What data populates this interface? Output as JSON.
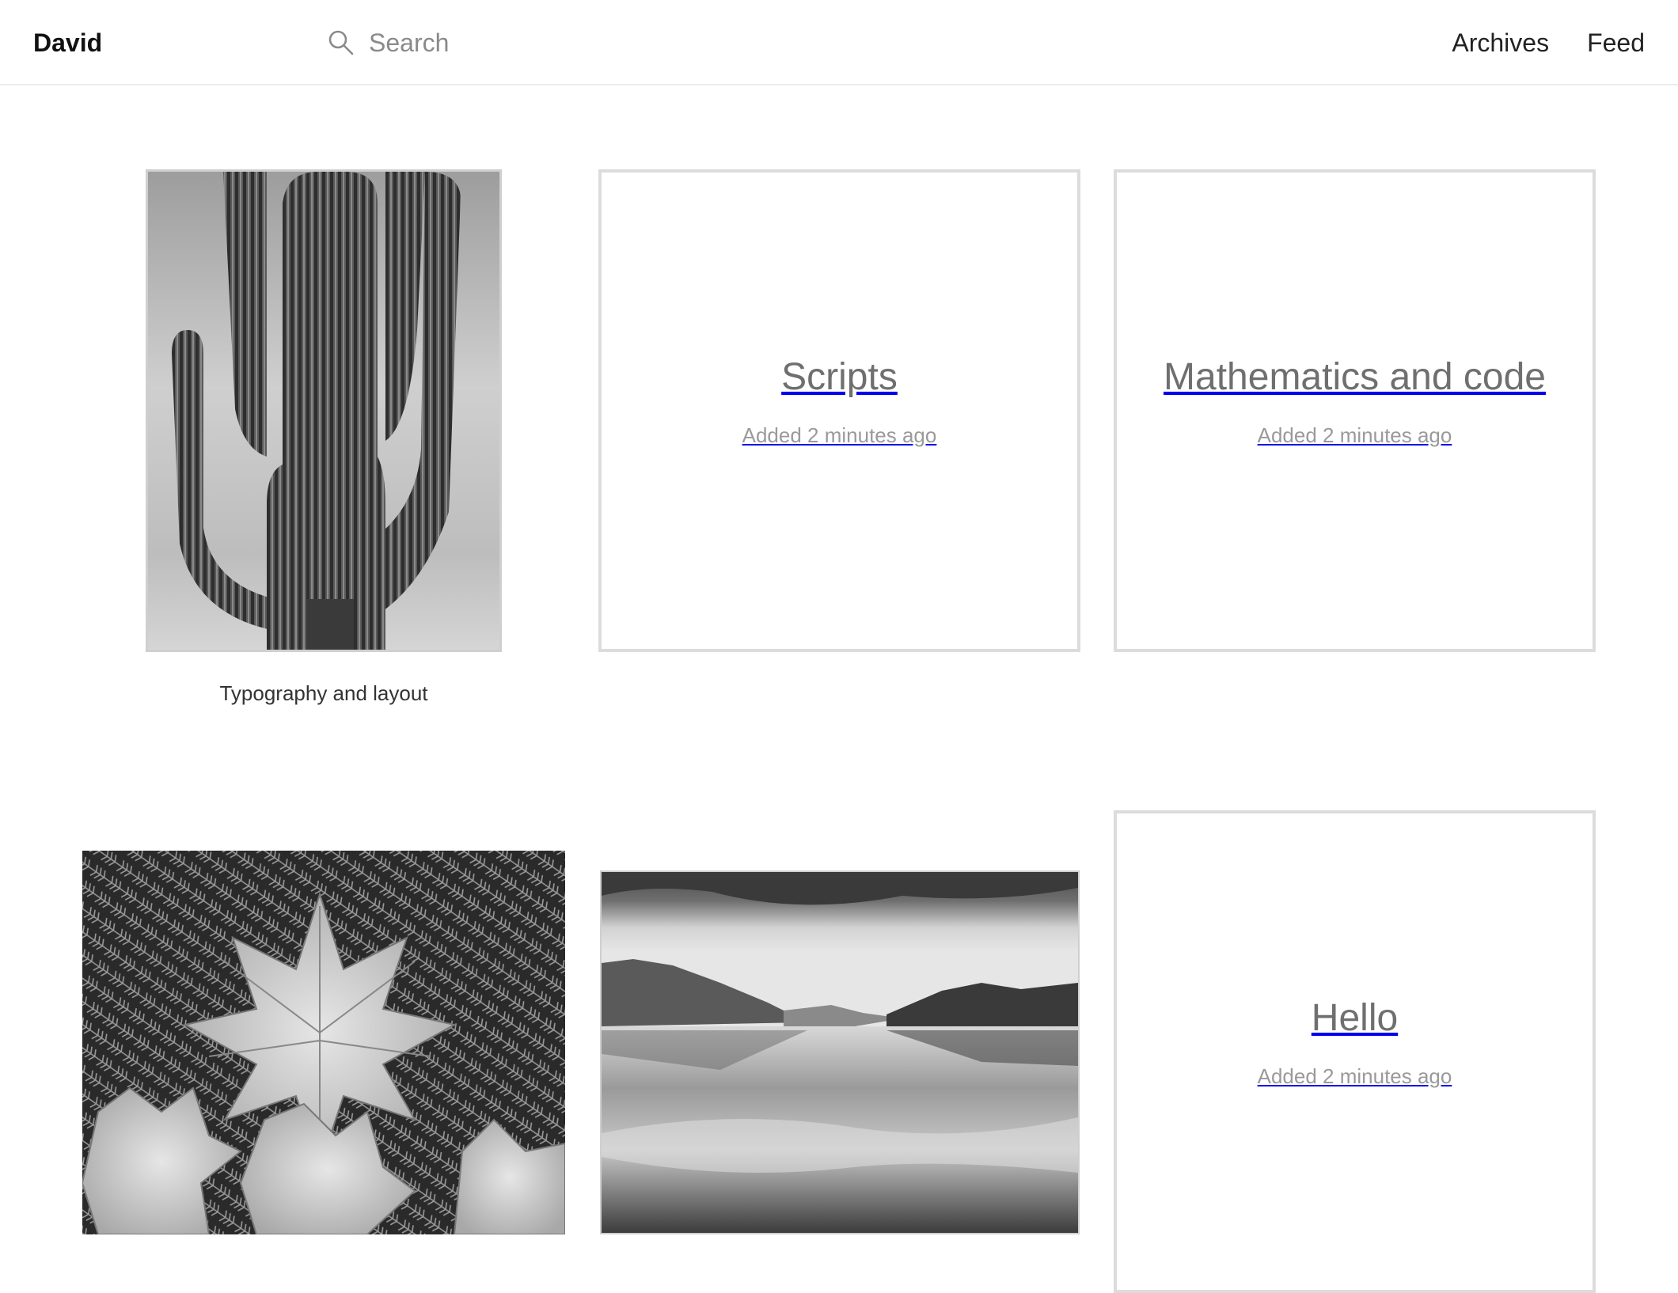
{
  "header": {
    "site_name": "David",
    "search": {
      "placeholder": "Search",
      "icon": "search-icon"
    },
    "nav": [
      {
        "label": "Archives"
      },
      {
        "label": "Feed"
      }
    ]
  },
  "grid": {
    "items": [
      {
        "kind": "photo",
        "image": "cactus-photo",
        "caption": "Typography and layout"
      },
      {
        "kind": "text",
        "title": "Scripts",
        "meta": "Added 2 minutes ago"
      },
      {
        "kind": "text",
        "title": "Mathematics and code",
        "meta": "Added 2 minutes ago"
      },
      {
        "kind": "photo",
        "image": "leaves-photo"
      },
      {
        "kind": "photo",
        "image": "lake-photo"
      },
      {
        "kind": "text",
        "title": "Hello",
        "meta": "Added 2 minutes ago"
      }
    ]
  }
}
